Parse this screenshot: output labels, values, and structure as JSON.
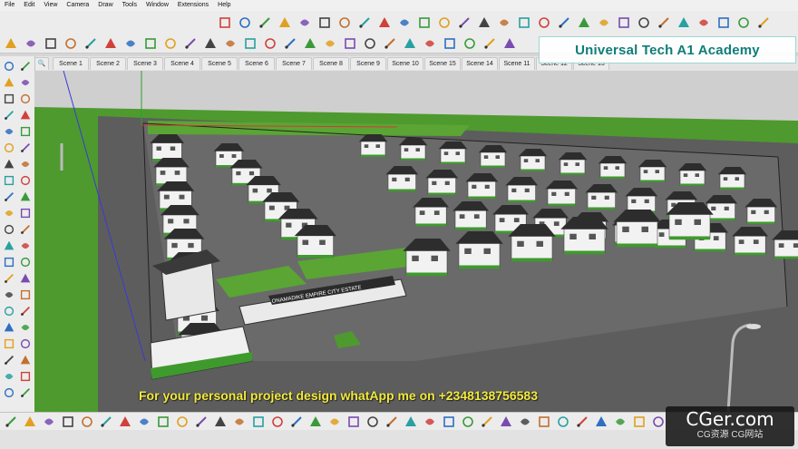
{
  "menu": [
    "File",
    "Edit",
    "View",
    "Camera",
    "Draw",
    "Tools",
    "Window",
    "Extensions",
    "Help"
  ],
  "scenes": [
    "Scene 1",
    "Scene 2",
    "Scene 3",
    "Scene 4",
    "Scene 5",
    "Scene 6",
    "Scene 7",
    "Scene 8",
    "Scene 9",
    "Scene 10",
    "Scene 15",
    "Scene 14",
    "Scene 11",
    "Scene 12",
    "Scene 13"
  ],
  "overlay": {
    "academy": "Universal Tech A1 Academy",
    "promo": "For your personal project design whatApp me on +2348138756583",
    "estate_sign": "ONAMADIKE EMPIRE CITY ESTATE",
    "watermark_main": "CGer.com",
    "watermark_sub": "CG资源 CG网站"
  },
  "colors": {
    "academy_text": "#0f7d78",
    "promo_text": "#f2ea3c",
    "grass": "#4e9a2e",
    "road": "#5a5a5a",
    "roof": "#2d2d2d",
    "wall": "#f2f2f2"
  },
  "icons": {
    "top_toolbar": [
      "select-icon",
      "eraser-icon",
      "paint-icon",
      "line-icon",
      "arc-icon",
      "rectangle-icon",
      "push-pull-icon",
      "move-icon",
      "rotate-icon",
      "scale-icon",
      "offset-icon",
      "tape-measure-icon",
      "text-icon",
      "axes-icon",
      "orbit-icon",
      "pan-icon",
      "zoom-icon",
      "zoom-extents-icon",
      "3d-warehouse-icon",
      "extension-warehouse-icon",
      "layout-icon",
      "style-icon",
      "shadow-icon",
      "fog-icon",
      "section-icon"
    ],
    "main_toolbar": [
      "new-icon",
      "open-icon",
      "save-icon",
      "cut-icon",
      "copy-icon",
      "paste-icon",
      "delete-icon",
      "undo-icon",
      "redo-icon",
      "print-icon",
      "model-info-icon",
      "search-icon",
      "select-arrow-icon",
      "eraser-icon",
      "pencil-icon",
      "arc-icon",
      "rectangle-icon",
      "push-pull-icon",
      "move-icon",
      "rotate-icon",
      "scale-icon",
      "offset-icon"
    ]
  }
}
